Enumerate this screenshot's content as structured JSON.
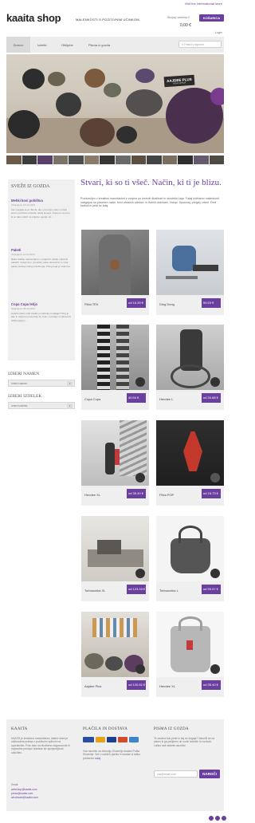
{
  "header": {
    "intl_link": "Visit the International store",
    "logo": "kaaita shop",
    "tagline": "MALENKOSTI S POZITIVNIM UČINKOM.",
    "cart_label": "Skupaj: vsebina 0",
    "cart_total": "0,00 €",
    "cart_button": "KOŠARICA",
    "login": "Login"
  },
  "nav": {
    "items": [
      "Domov",
      "Izdelki",
      "Oblijube",
      "Pisma iz gozda"
    ],
    "search_placeholder": "Poišči v trgovini"
  },
  "hero": {
    "tag_title": "AAJDEE PLUS",
    "tag_sub": "NOVA SERIJA"
  },
  "sidebar": {
    "news_title": "SVEŽE IZ GOZDA",
    "news": [
      {
        "title": "Mehki kosi pohištva",
        "date": "Objavljeno 16.10.2013",
        "text": "Kar manjkal so je: Bimbi, da s pomočjo našin mehkih kosov pohištva ustvarite nekaj lepega. Tukaj so za dom, ki se tako odloči za prijetno ugodje ob ..."
      },
      {
        "title": "Paketi",
        "date": "Objavljeno 11.10.2013",
        "text": "Naše izdelke odpremljamo v prijaznih, okolju prijaznih paketih. Veseli smo, da lahko paket obarvamo in vsak paket vsebuje nekaj posebnega. Poleg tega je vsak kos ..."
      },
      {
        "title": "Copa Copa letijo",
        "date": "Objavljeno 05.10.2013",
        "text": "Ugarite kateri naši izdelki ju najbolje prodajajo? Rog je dan in odgovor posreduje že znan s prodajo in zabavnim oblikovanjem ..."
      }
    ],
    "filter_name_label": "IZBERI NAMEN",
    "filter_name_value": "Izberi namen",
    "filter_product_label": "IZBERI IZDELEK",
    "filter_product_value": "Izberi izdelek"
  },
  "main": {
    "title": "Stvari, ki so ti všeč. Način, ki ti je blizu.",
    "intro": "Pozdravljen v kreativni manufakturi z vonjem po lesenih škatlicah in skodelici čaja. Tukaj izdelamo malenkosti nadgajna na poseben način, brez strankih učinkov in dobrih dobrinah. Vstopi. Spusmaj, preglej, izberi. Reci karkoli in pridi še kdaj."
  },
  "products": [
    {
      "name": "Fibia TEK",
      "price": "od 16.39 €"
    },
    {
      "name": "Ding Dong",
      "price": "59.53 €"
    },
    {
      "name": "Copa Copa",
      "price": "40.94 €"
    },
    {
      "name": "Hendee L",
      "price": "od 34.68 €"
    },
    {
      "name": "Hendee XL",
      "price": "od 35.40 €"
    },
    {
      "name": "Fibia POP",
      "price": "od 16.73 €"
    },
    {
      "name": "Torbuschka XL",
      "price": "od 123.93 €"
    },
    {
      "name": "Torbuschka L",
      "price": "od 93.97 €"
    },
    {
      "name": "Aajdee Plus",
      "price": "od 120.82 €"
    },
    {
      "name": "Hendee XL",
      "price": "od 35.40 €"
    }
  ],
  "footer": {
    "col1_title": "KAAITA",
    "col1_text": "KAAITA je kreativna manufaktura, katere stran je oblikovalna praksa z pozitivnim vplivom na uporabnike. Prav tako na družbeno odgovornost in trajnostne principe izdelave ter sprejemljivost odločitev.",
    "col1_email_label": "Email:",
    "col1_emails": [
      "webshop@kaaita.com",
      "press@kaaita.com",
      "wholesale@kaaita.com"
    ],
    "col2_title": "PLAČILA IN DOSTAVA",
    "col2_text": "Vse naročilo na območju Slovenije dostavi Pošta Slovenije. Več o načinih plačila in dostavi si lahko preberete",
    "col2_link": "tukaj",
    "col3_title": "PISMA IZ GOZDA",
    "col3_text": "Te zanima kdo pride in kaj se dogaja? Naročili se na pismo ki ga pošljemo ob novih izdelkih in novicah. Lahko tudi ukinete naročilo!",
    "newsletter_placeholder": "vas@email.com",
    "newsletter_button": "NAROČI"
  },
  "colors": {
    "accent": "#6b3fa0"
  }
}
